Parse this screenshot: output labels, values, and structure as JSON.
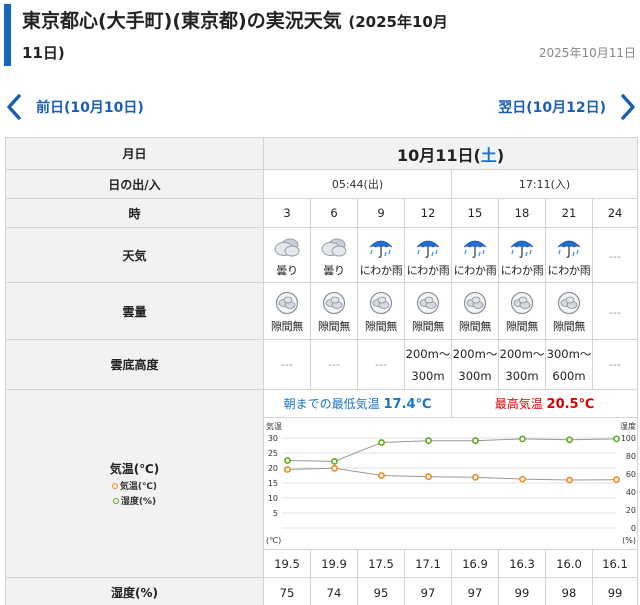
{
  "header": {
    "title_main": "東京都心(大手町)(東京都)の実況天気",
    "title_date_a": "(2025年10月",
    "title_date_b": "11日)",
    "date_right": "2025年10月11日"
  },
  "nav": {
    "prev_label": "前日(10月10日)",
    "next_label": "翌日(10月12日)"
  },
  "table": {
    "label_date": "月日",
    "date_text": "10月11日(",
    "date_dow": "土",
    "date_close": ")",
    "label_sun": "日の出/入",
    "sunrise": "05:44(出)",
    "sunset": "17:11(入)",
    "label_hour": "時",
    "hours": [
      "3",
      "6",
      "9",
      "12",
      "15",
      "18",
      "21",
      "24"
    ],
    "label_weather": "天気",
    "weather": [
      {
        "icon": "cloudy-icon",
        "text": "曇り"
      },
      {
        "icon": "cloudy-icon",
        "text": "曇り"
      },
      {
        "icon": "umbrella-rain-icon",
        "text": "にわか雨"
      },
      {
        "icon": "umbrella-rain-icon",
        "text": "にわか雨"
      },
      {
        "icon": "umbrella-rain-icon",
        "text": "にわか雨"
      },
      {
        "icon": "umbrella-rain-icon",
        "text": "にわか雨"
      },
      {
        "icon": "umbrella-rain-icon",
        "text": "にわか雨"
      },
      {
        "icon": "",
        "text": "---"
      }
    ],
    "label_cloud": "雲量",
    "cloud": [
      {
        "icon": "overcast-icon",
        "text": "隙間無"
      },
      {
        "icon": "overcast-icon",
        "text": "隙間無"
      },
      {
        "icon": "overcast-icon",
        "text": "隙間無"
      },
      {
        "icon": "overcast-icon",
        "text": "隙間無"
      },
      {
        "icon": "overcast-icon",
        "text": "隙間無"
      },
      {
        "icon": "overcast-icon",
        "text": "隙間無"
      },
      {
        "icon": "overcast-icon",
        "text": "隙間無"
      },
      {
        "icon": "",
        "text": "---"
      }
    ],
    "label_ceiling": "雲底高度",
    "ceiling": [
      {
        "a": "---",
        "b": ""
      },
      {
        "a": "---",
        "b": ""
      },
      {
        "a": "---",
        "b": ""
      },
      {
        "a": "200m～",
        "b": "300m"
      },
      {
        "a": "200m～",
        "b": "300m"
      },
      {
        "a": "200m～",
        "b": "300m"
      },
      {
        "a": "300m～",
        "b": "600m"
      },
      {
        "a": "---",
        "b": ""
      }
    ],
    "label_temp": "気温(℃)",
    "legend_temp": "気温(℃)",
    "legend_hum": "湿度(%)",
    "min_label": "朝までの最低気温",
    "min_value": "17.4℃",
    "max_label": "最高気温",
    "max_value": "20.5℃",
    "temps": [
      "19.5",
      "19.9",
      "17.5",
      "17.1",
      "16.9",
      "16.3",
      "16.0",
      "16.1"
    ],
    "label_humidity": "湿度(%)",
    "humidity": [
      "75",
      "74",
      "95",
      "97",
      "97",
      "99",
      "98",
      "99"
    ]
  },
  "chart_data": {
    "type": "line",
    "x": [
      "3",
      "6",
      "9",
      "12",
      "15",
      "18",
      "21",
      "24"
    ],
    "left_axis_title": "気温",
    "left_axis_unit": "(℃)",
    "right_axis_title": "湿度",
    "right_axis_unit": "(%)",
    "left_ticks": [
      "30",
      "25",
      "20",
      "15",
      "10",
      "5"
    ],
    "right_ticks": [
      "100",
      "80",
      "60",
      "40",
      "20",
      "0"
    ],
    "ylim_left": [
      0,
      30
    ],
    "ylim_right": [
      0,
      100
    ],
    "grid": true,
    "series": [
      {
        "name": "気温(℃)",
        "axis": "left",
        "color": "#f08a1c",
        "values": [
          19.5,
          19.9,
          17.5,
          17.1,
          16.9,
          16.3,
          16.0,
          16.1
        ]
      },
      {
        "name": "湿度(%)",
        "axis": "right",
        "color": "#5aaa1e",
        "values": [
          75,
          74,
          95,
          97,
          97,
          99,
          98,
          99
        ]
      }
    ]
  }
}
